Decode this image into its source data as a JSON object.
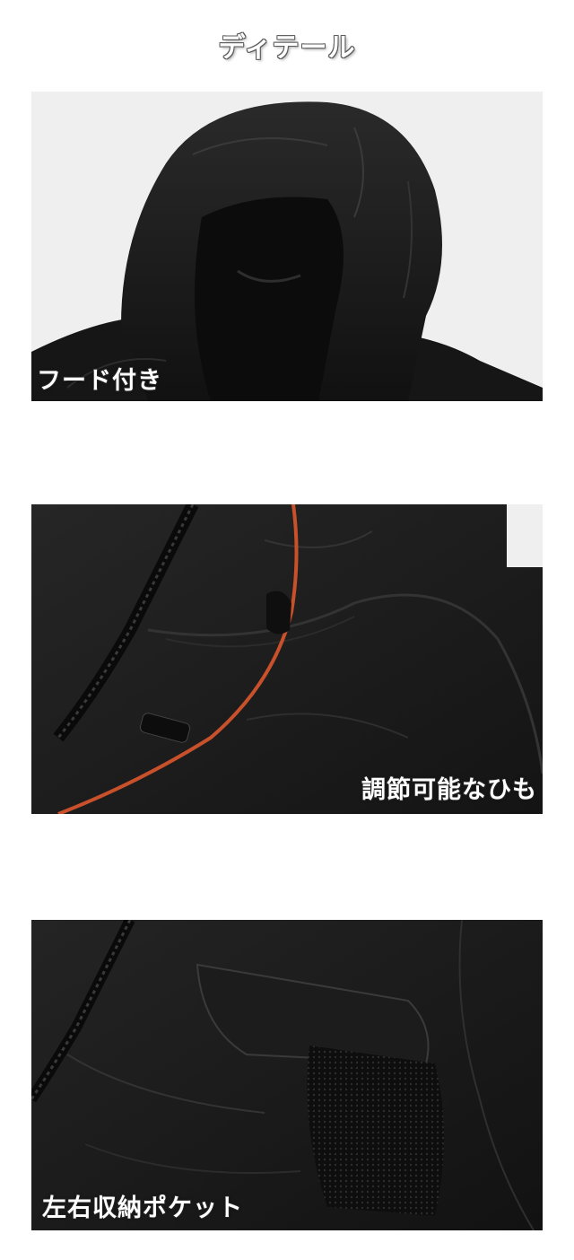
{
  "page": {
    "title": "ディテール"
  },
  "panels": [
    {
      "caption": "フード付き",
      "icon": "hood-photo"
    },
    {
      "caption": "調節可能なひも",
      "icon": "drawstring-photo"
    },
    {
      "caption": "左右収納ポケット",
      "icon": "pocket-photo"
    }
  ],
  "colors": {
    "fabric": "#1a1a1a",
    "background_light": "#efefef",
    "drawstring": "#c8502a"
  }
}
